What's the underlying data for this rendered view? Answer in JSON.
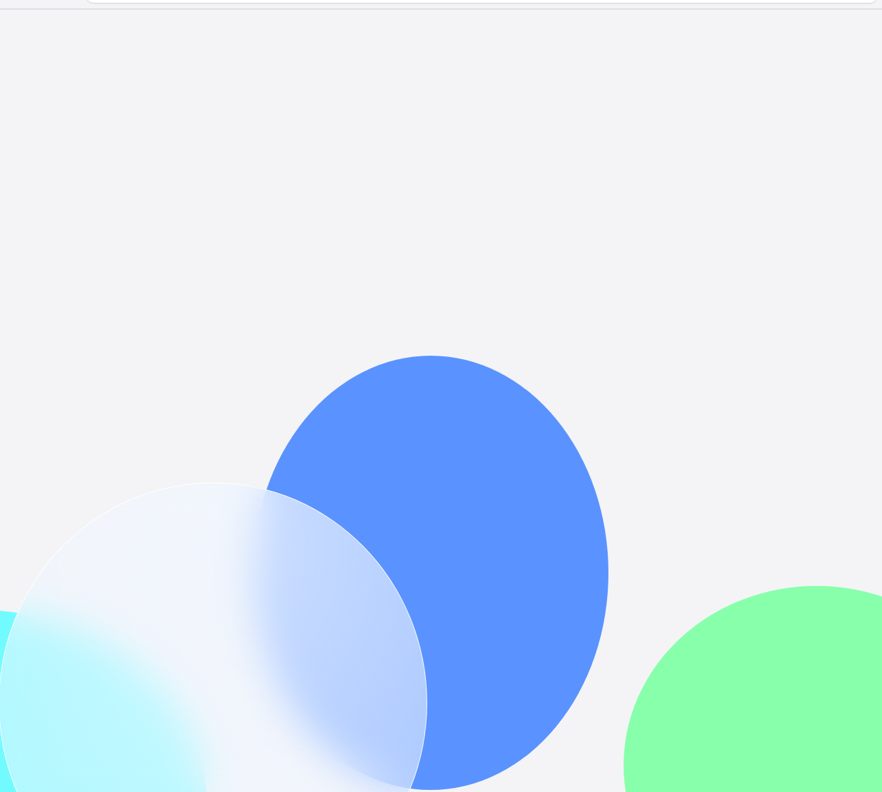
{
  "decorations": [
    {
      "kind": "disc",
      "color": "#5a93ff"
    },
    {
      "kind": "disc",
      "color": "#88ffab"
    },
    {
      "kind": "disc",
      "color": "#72fbff"
    },
    {
      "kind": "glass"
    }
  ]
}
